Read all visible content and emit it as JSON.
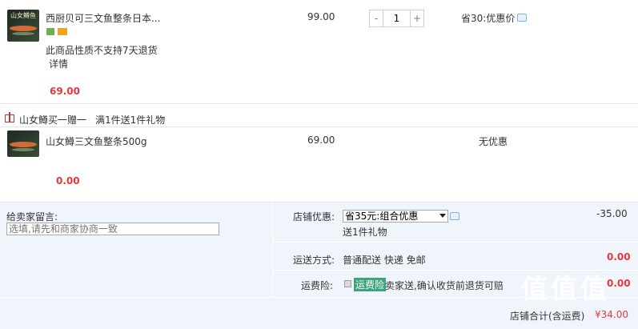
{
  "product1": {
    "thumb_brand": "山女鳟鱼",
    "title": "西厨贝可三文鱼整条日本...",
    "unit_price": "99.00",
    "quantity": "1",
    "discount_text": "省30:优惠价",
    "notice": "此商品性质不支持7天退货",
    "detail_link": "详情",
    "subtotal": "69.00"
  },
  "gift": {
    "header": "山女鳟买一赠一",
    "rule": "满1件送1件礼物",
    "item_title": "山女鳟三文鱼整条500g",
    "unit_price": "69.00",
    "discount_text": "无优惠",
    "subtotal": "0.00"
  },
  "order": {
    "message_label": "给卖家留言:",
    "message_placeholder": "选填,请先和商家协商一致",
    "shop_discount_label": "店铺优惠:",
    "shop_discount_selected": "省35元:组合优惠",
    "shop_discount_amount": "-35.00",
    "gift_note": "送1件礼物",
    "shipping_label": "运送方式:",
    "shipping_method": "普通配送 快递 免邮",
    "shipping_amount": "0.00",
    "insurance_label": "运费险:",
    "insurance_badge": "运费险",
    "insurance_desc": "卖家送,确认收货前退货可赔",
    "insurance_amount": "0.00",
    "total_label": "店铺合计(含运费)",
    "total_amount": "¥34.00"
  },
  "watermark": "值值值"
}
